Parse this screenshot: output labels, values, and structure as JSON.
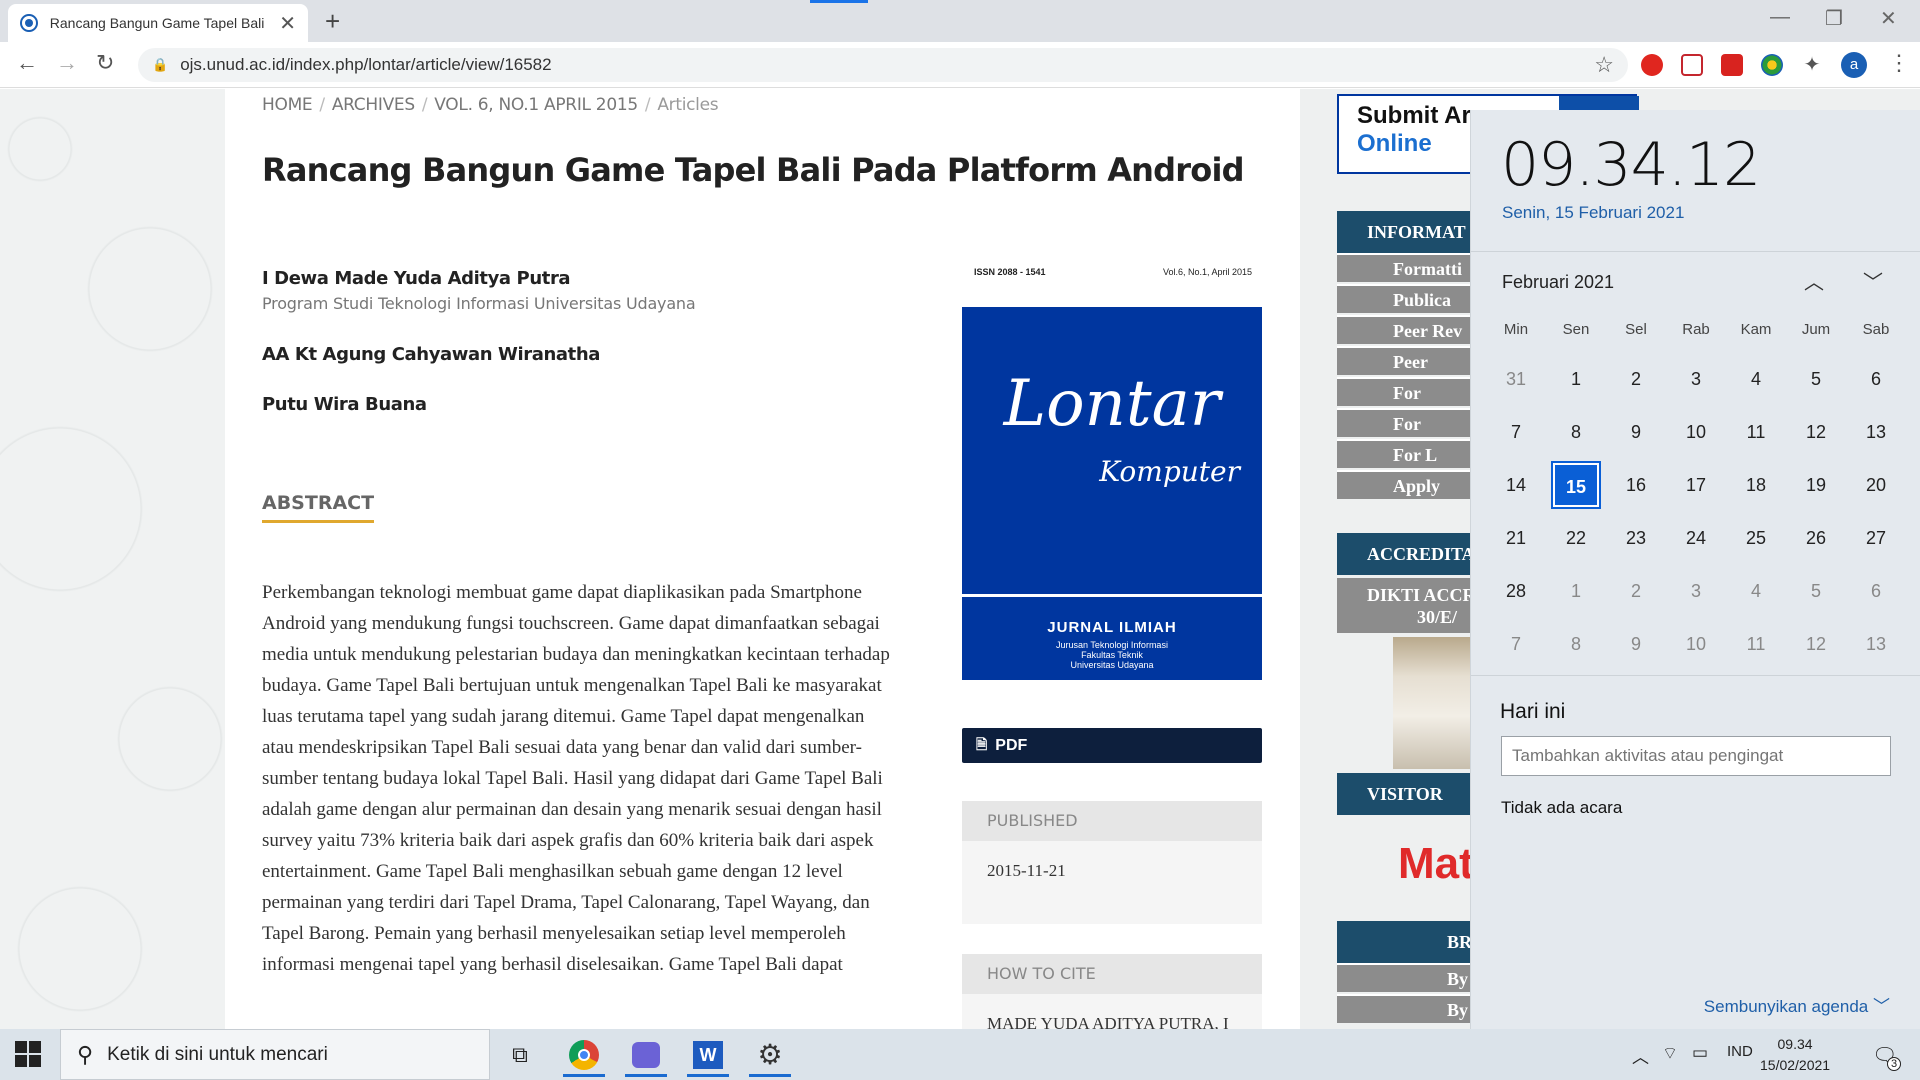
{
  "browser": {
    "tab_title": "Rancang Bangun Game Tapel Bali",
    "url": "ojs.unud.ac.id/index.php/lontar/article/view/16582"
  },
  "breadcrumb": [
    "HOME",
    "ARCHIVES",
    "VOL. 6, NO.1 APRIL 2015",
    "Articles"
  ],
  "article": {
    "title": "Rancang Bangun Game Tapel Bali Pada Platform Android",
    "authors": [
      {
        "name": "I Dewa Made Yuda Aditya Putra",
        "affiliation": "Program Studi Teknologi Informasi Universitas Udayana"
      },
      {
        "name": "AA Kt Agung Cahyawan Wiranatha",
        "affiliation": ""
      },
      {
        "name": "Putu Wira Buana",
        "affiliation": ""
      }
    ],
    "abstract_heading": "ABSTRACT",
    "abstract": "Perkembangan teknologi membuat game dapat diaplikasikan pada Smartphone Android yang mendukung fungsi touchscreen. Game dapat dimanfaatkan sebagai media untuk mendukung pelestarian budaya dan meningkatkan kecintaan terhadap budaya. Game Tapel Bali bertujuan untuk mengenalkan Tapel Bali ke masyarakat luas terutama tapel yang sudah jarang ditemui. Game Tapel dapat mengenalkan atau mendeskripsikan Tapel Bali sesuai data yang benar dan valid dari sumber-sumber tentang budaya lokal Tapel Bali. Hasil yang didapat dari Game Tapel Bali adalah game dengan alur permainan dan desain yang menarik sesuai dengan hasil survey yaitu 73% kriteria baik dari aspek grafis dan 60% kriteria baik dari aspek entertainment. Game Tapel Bali menghasilkan sebuah game dengan 12 level permainan yang terdiri dari Tapel Drama, Tapel Calonarang, Tapel Wayang, dan Tapel Barong. Pemain yang berhasil menyelesaikan setiap level memperoleh informasi mengenai tapel yang berhasil diselesaikan. Game Tapel Bali dapat"
  },
  "cover": {
    "issn": "ISSN 2088 - 1541",
    "vol": "Vol.6, No.1, April 2015",
    "title": "Lontar",
    "subtitle": "Komputer",
    "jurnal": "JURNAL ILMIAH",
    "line1": "Jurusan Teknologi Informasi",
    "line2": "Fakultas Teknik",
    "line3": "Universitas Udayana"
  },
  "pdf_label": "PDF",
  "published": {
    "heading": "PUBLISHED",
    "value": "2015-11-21"
  },
  "cite": {
    "heading": "HOW TO CITE",
    "value": "MADE YUDA ADITYA PUTRA, I"
  },
  "sidebar": {
    "submit_a": "Submit Ar",
    "submit_b": "Online",
    "info_heading": "INFORMAT",
    "info_items": [
      "Formatti",
      "Publica",
      "Peer Rev",
      "Peer",
      "For",
      "For",
      "For L",
      "Apply"
    ],
    "accred_heading": "ACCREDITA",
    "dikti_a": "DIKTI ACCR",
    "dikti_b": "30/E/",
    "visitor_heading": "VISITOR",
    "mat": "Mat",
    "br_heading": "BR",
    "by_items": [
      "By",
      "By"
    ]
  },
  "calendar": {
    "time": "09.34.12",
    "date": "Senin, 15 Februari 2021",
    "month": "Februari 2021",
    "dow": [
      "Min",
      "Sen",
      "Sel",
      "Rab",
      "Kam",
      "Jum",
      "Sab"
    ],
    "weeks": [
      [
        "31",
        "1",
        "2",
        "3",
        "4",
        "5",
        "6"
      ],
      [
        "7",
        "8",
        "9",
        "10",
        "11",
        "12",
        "13"
      ],
      [
        "14",
        "15",
        "16",
        "17",
        "18",
        "19",
        "20"
      ],
      [
        "21",
        "22",
        "23",
        "24",
        "25",
        "26",
        "27"
      ],
      [
        "28",
        "1",
        "2",
        "3",
        "4",
        "5",
        "6"
      ],
      [
        "7",
        "8",
        "9",
        "10",
        "11",
        "12",
        "13"
      ]
    ],
    "today": "15",
    "hari_ini": "Hari ini",
    "add_placeholder": "Tambahkan aktivitas atau pengingat",
    "no_events": "Tidak ada acara",
    "hide_agenda": "Sembunyikan agenda"
  },
  "taskbar": {
    "search_text": "Ketik di sini untuk mencari",
    "lang": "IND",
    "time": "09.34",
    "date": "15/02/2021",
    "notif_count": "3"
  }
}
